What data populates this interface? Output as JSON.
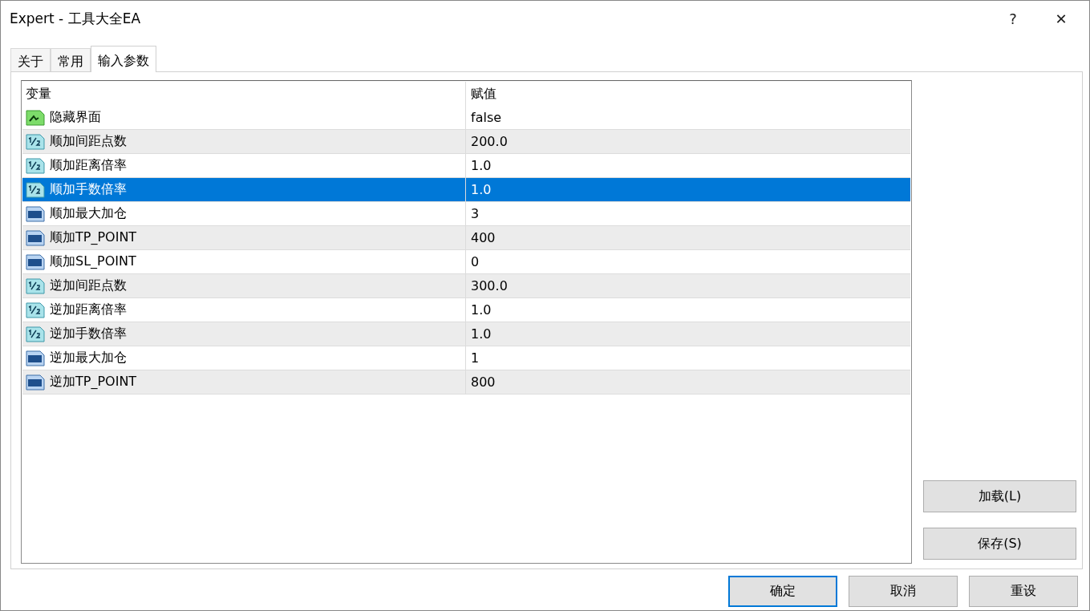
{
  "window": {
    "title": "Expert - 工具大全EA",
    "help": "?",
    "close": "✕"
  },
  "tabs": [
    {
      "label": "关于",
      "selected": false
    },
    {
      "label": "常用",
      "selected": false
    },
    {
      "label": "输入参数",
      "selected": true
    }
  ],
  "table": {
    "columns": [
      "变量",
      "赋值"
    ],
    "rows": [
      {
        "kind": "bool",
        "name": "隐藏界面",
        "value": "false",
        "selected": false
      },
      {
        "kind": "double",
        "name": "顺加间距点数",
        "value": "200.0",
        "selected": false
      },
      {
        "kind": "double",
        "name": "顺加距离倍率",
        "value": "1.0",
        "selected": false
      },
      {
        "kind": "double",
        "name": "顺加手数倍率",
        "value": "1.0",
        "selected": true
      },
      {
        "kind": "int",
        "name": "顺加最大加仓",
        "value": "3",
        "selected": false
      },
      {
        "kind": "int",
        "name": "顺加TP_POINT",
        "value": "400",
        "selected": false
      },
      {
        "kind": "int",
        "name": "顺加SL_POINT",
        "value": "0",
        "selected": false
      },
      {
        "kind": "double",
        "name": "逆加间距点数",
        "value": "300.0",
        "selected": false
      },
      {
        "kind": "double",
        "name": "逆加距离倍率",
        "value": "1.0",
        "selected": false
      },
      {
        "kind": "double",
        "name": "逆加手数倍率",
        "value": "1.0",
        "selected": false
      },
      {
        "kind": "int",
        "name": "逆加最大加仓",
        "value": "1",
        "selected": false
      },
      {
        "kind": "int",
        "name": "逆加TP_POINT",
        "value": "800",
        "selected": false
      }
    ]
  },
  "side_buttons": [
    "加载(L)",
    "保存(S)"
  ],
  "buttons": [
    {
      "label": "确定",
      "default": true
    },
    {
      "label": "取消",
      "default": false
    },
    {
      "label": "重设",
      "default": false
    }
  ]
}
